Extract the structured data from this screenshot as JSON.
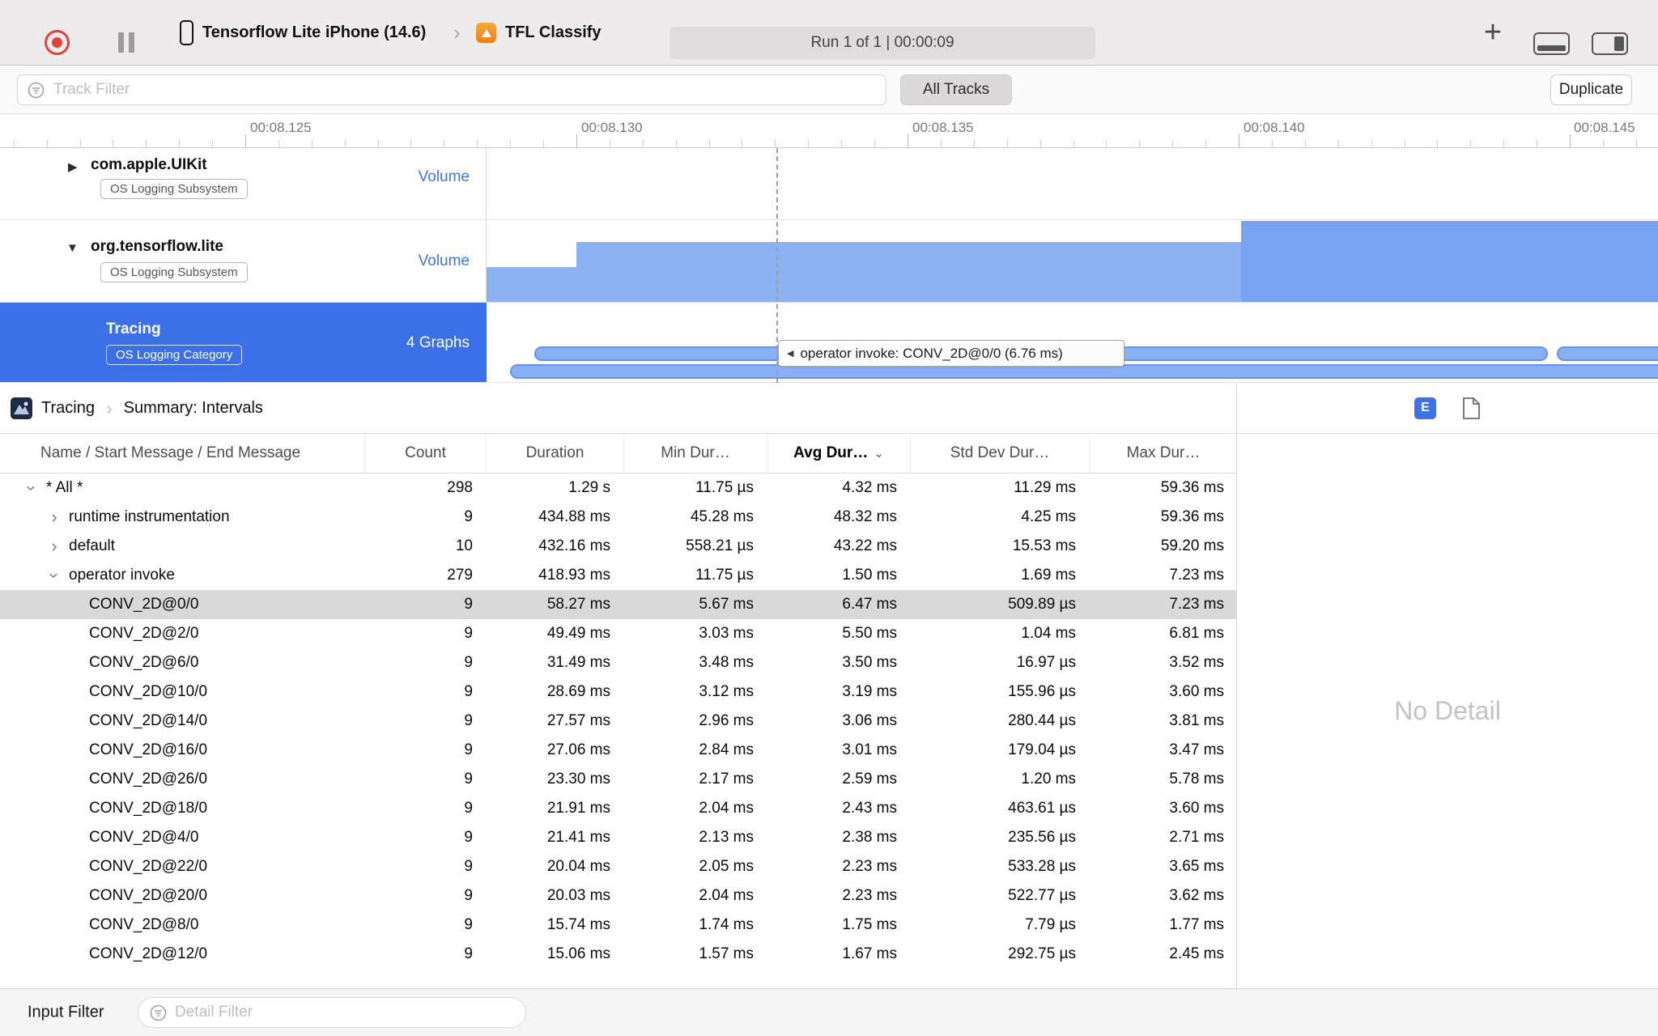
{
  "toolbar": {
    "device": "Tensorflow Lite iPhone (14.6)",
    "target": "TFL Classify",
    "run_status": "Run 1 of 1  |  00:00:09"
  },
  "filter_bar": {
    "track_filter_placeholder": "Track Filter",
    "all_tracks_label": "All Tracks",
    "duplicate_label": "Duplicate"
  },
  "ruler": {
    "labels": [
      "00:08.125",
      "00:08.130",
      "00:08.135",
      "00:08.140",
      "00:08.145"
    ]
  },
  "tracks": [
    {
      "name": "com.apple.UIKit",
      "badge": "OS Logging Subsystem",
      "meta": "Volume",
      "state": "collapsed"
    },
    {
      "name": "org.tensorflow.lite",
      "badge": "OS Logging Subsystem",
      "meta": "Volume",
      "state": "expanded"
    },
    {
      "name": "Tracing",
      "badge": "OS Logging Category",
      "meta": "4 Graphs",
      "state": "selected"
    }
  ],
  "timeline": {
    "tooltip": "operator invoke: CONV_2D@0/0 (6.76 ms)"
  },
  "breadcrumb": {
    "items": [
      "Tracing",
      "Summary: Intervals"
    ],
    "extended_detail_badge": "E"
  },
  "table": {
    "columns": [
      "Name / Start Message / End Message",
      "Count",
      "Duration",
      "Min Dur…",
      "Avg Dur…",
      "Std Dev Dur…",
      "Max Dur…"
    ],
    "sorted_column": "Avg Dur…",
    "rows": [
      {
        "name": "* All *",
        "level": 0,
        "disclosure": "down",
        "selected": false,
        "count": "298",
        "duration": "1.29 s",
        "min": "11.75 µs",
        "avg": "4.32 ms",
        "std": "11.29 ms",
        "max": "59.36 ms"
      },
      {
        "name": "runtime instrumentation",
        "level": 1,
        "disclosure": "right",
        "selected": false,
        "count": "9",
        "duration": "434.88 ms",
        "min": "45.28 ms",
        "avg": "48.32 ms",
        "std": "4.25 ms",
        "max": "59.36 ms"
      },
      {
        "name": "default",
        "level": 1,
        "disclosure": "right",
        "selected": false,
        "count": "10",
        "duration": "432.16 ms",
        "min": "558.21 µs",
        "avg": "43.22 ms",
        "std": "15.53 ms",
        "max": "59.20 ms"
      },
      {
        "name": "operator invoke",
        "level": 1,
        "disclosure": "down",
        "selected": false,
        "count": "279",
        "duration": "418.93 ms",
        "min": "11.75 µs",
        "avg": "1.50 ms",
        "std": "1.69 ms",
        "max": "7.23 ms"
      },
      {
        "name": "CONV_2D@0/0",
        "level": 2,
        "disclosure": "none",
        "selected": true,
        "count": "9",
        "duration": "58.27 ms",
        "min": "5.67 ms",
        "avg": "6.47 ms",
        "std": "509.89 µs",
        "max": "7.23 ms"
      },
      {
        "name": "CONV_2D@2/0",
        "level": 2,
        "disclosure": "none",
        "selected": false,
        "count": "9",
        "duration": "49.49 ms",
        "min": "3.03 ms",
        "avg": "5.50 ms",
        "std": "1.04 ms",
        "max": "6.81 ms"
      },
      {
        "name": "CONV_2D@6/0",
        "level": 2,
        "disclosure": "none",
        "selected": false,
        "count": "9",
        "duration": "31.49 ms",
        "min": "3.48 ms",
        "avg": "3.50 ms",
        "std": "16.97 µs",
        "max": "3.52 ms"
      },
      {
        "name": "CONV_2D@10/0",
        "level": 2,
        "disclosure": "none",
        "selected": false,
        "count": "9",
        "duration": "28.69 ms",
        "min": "3.12 ms",
        "avg": "3.19 ms",
        "std": "155.96 µs",
        "max": "3.60 ms"
      },
      {
        "name": "CONV_2D@14/0",
        "level": 2,
        "disclosure": "none",
        "selected": false,
        "count": "9",
        "duration": "27.57 ms",
        "min": "2.96 ms",
        "avg": "3.06 ms",
        "std": "280.44 µs",
        "max": "3.81 ms"
      },
      {
        "name": "CONV_2D@16/0",
        "level": 2,
        "disclosure": "none",
        "selected": false,
        "count": "9",
        "duration": "27.06 ms",
        "min": "2.84 ms",
        "avg": "3.01 ms",
        "std": "179.04 µs",
        "max": "3.47 ms"
      },
      {
        "name": "CONV_2D@26/0",
        "level": 2,
        "disclosure": "none",
        "selected": false,
        "count": "9",
        "duration": "23.30 ms",
        "min": "2.17 ms",
        "avg": "2.59 ms",
        "std": "1.20 ms",
        "max": "5.78 ms"
      },
      {
        "name": "CONV_2D@18/0",
        "level": 2,
        "disclosure": "none",
        "selected": false,
        "count": "9",
        "duration": "21.91 ms",
        "min": "2.04 ms",
        "avg": "2.43 ms",
        "std": "463.61 µs",
        "max": "3.60 ms"
      },
      {
        "name": "CONV_2D@4/0",
        "level": 2,
        "disclosure": "none",
        "selected": false,
        "count": "9",
        "duration": "21.41 ms",
        "min": "2.13 ms",
        "avg": "2.38 ms",
        "std": "235.56 µs",
        "max": "2.71 ms"
      },
      {
        "name": "CONV_2D@22/0",
        "level": 2,
        "disclosure": "none",
        "selected": false,
        "count": "9",
        "duration": "20.04 ms",
        "min": "2.05 ms",
        "avg": "2.23 ms",
        "std": "533.28 µs",
        "max": "3.65 ms"
      },
      {
        "name": "CONV_2D@20/0",
        "level": 2,
        "disclosure": "none",
        "selected": false,
        "count": "9",
        "duration": "20.03 ms",
        "min": "2.04 ms",
        "avg": "2.23 ms",
        "std": "522.77 µs",
        "max": "3.62 ms"
      },
      {
        "name": "CONV_2D@8/0",
        "level": 2,
        "disclosure": "none",
        "selected": false,
        "count": "9",
        "duration": "15.74 ms",
        "min": "1.74 ms",
        "avg": "1.75 ms",
        "std": "7.79 µs",
        "max": "1.77 ms"
      },
      {
        "name": "CONV_2D@12/0",
        "level": 2,
        "disclosure": "none",
        "selected": false,
        "count": "9",
        "duration": "15.06 ms",
        "min": "1.57 ms",
        "avg": "1.67 ms",
        "std": "292.75 µs",
        "max": "2.45 ms"
      }
    ]
  },
  "detail_panel": {
    "empty_text": "No Detail"
  },
  "bottom_bar": {
    "input_filter_label": "Input Filter",
    "detail_filter_placeholder": "Detail Filter"
  },
  "colors": {
    "selection_blue": "#3B70E8",
    "interval_capsule": "#8AAFF4",
    "volume_fill": "#8DB2F4",
    "volume_fill_dark": "#78A3F2",
    "link_blue": "#3E74E9",
    "record_red": "#E0433B",
    "app_icon_orange": "#EC7F1B"
  }
}
